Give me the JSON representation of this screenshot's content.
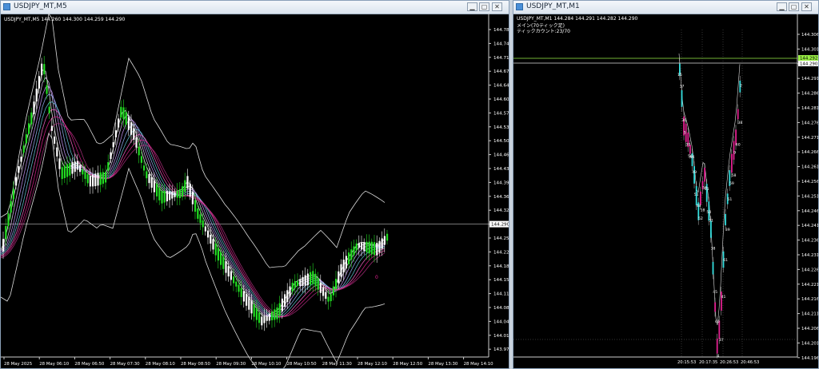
{
  "windows": {
    "left": {
      "title": "USDJPY_MT,M5",
      "symbol_line": "USDJPY_MT,M5  144.260 144.300 144.259 144.290",
      "price_labels": [
        "144.780",
        "144.745",
        "144.710",
        "144.675",
        "144.640",
        "144.605",
        "144.570",
        "144.535",
        "144.500",
        "144.465",
        "144.430",
        "144.395",
        "144.360",
        "144.325",
        "144.290",
        "144.255",
        "144.220",
        "144.185",
        "144.150",
        "144.115",
        "144.080",
        "144.045",
        "144.010",
        "143.975"
      ],
      "current_price": "144.290",
      "time_labels": [
        "28 May 2025",
        "28 May 06:10",
        "28 May 06:50",
        "28 May 07:30",
        "28 May 08:10",
        "28 May 08:50",
        "28 May 09:30",
        "28 May 10:10",
        "28 May 10:50",
        "28 May 11:30",
        "28 May 12:10",
        "28 May 12:50",
        "28 May 13:30",
        "28 May 14:10"
      ],
      "marker": "0"
    },
    "right": {
      "title": "USDJPY_MT,M1",
      "symbol_line": "USDJPY_MT,M1  144.284 144.291 144.282 144.290",
      "line2": "メイン(70ティック足)",
      "line3": "ティックカウント:23/70",
      "price_labels": [
        "144.306",
        "144.301",
        "144.296",
        "144.291",
        "144.286",
        "144.281",
        "144.276",
        "144.271",
        "144.266",
        "144.261",
        "144.256",
        "144.251",
        "144.246",
        "144.241",
        "144.236",
        "144.231",
        "144.226",
        "144.221",
        "144.216",
        "144.211",
        "144.206",
        "144.201",
        "144.196"
      ],
      "highlight_price_1": "144.292",
      "highlight_price_2": "144.290",
      "time_labels": [
        "20:15:53",
        "20:17:35",
        "20:26:53",
        "20:46:53"
      ],
      "tick_counts": [
        "15",
        "37",
        "36",
        "5",
        "39",
        "56",
        "44",
        "49",
        "51",
        "48",
        "52",
        "18",
        "56",
        "61",
        "50",
        "31",
        "38",
        "45",
        "46",
        "4",
        "37",
        "41",
        "61",
        "39",
        "51",
        "59",
        "58",
        "9",
        "60",
        "38",
        "2"
      ]
    }
  },
  "colors": {
    "bull_candle": "#22dd22",
    "bear_candle": "#ffffff",
    "band": "#dddddd",
    "accent_magenta": "#e0208f",
    "accent_cyan": "#33dddd",
    "highlight_green": "#99ee44"
  },
  "icons": [
    "chart-window-icon",
    "minimize-icon",
    "maximize-icon",
    "close-icon"
  ]
}
